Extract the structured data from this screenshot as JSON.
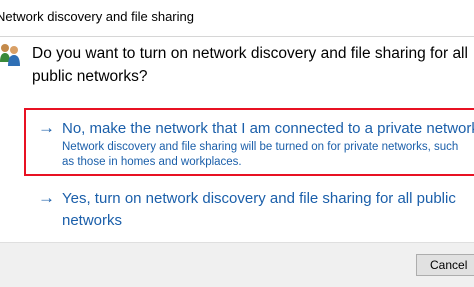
{
  "window": {
    "title": "Network discovery and file sharing"
  },
  "prompt": {
    "question": "Do you want to turn on network discovery and file sharing for all public networks?",
    "icon": "users-icon"
  },
  "options": [
    {
      "arrow": "→",
      "title": "No, make the network that I am connected to a private network",
      "description": "Network discovery and file sharing will be turned on for private networks, such as those in homes and workplaces.",
      "highlight_color": "#e81123"
    },
    {
      "arrow": "→",
      "title": "Yes, turn on network discovery and file sharing for all public networks"
    }
  ],
  "footer": {
    "cancel_label": "Cancel"
  },
  "colors": {
    "link_blue": "#1b5faa",
    "footer_bg": "#f0f0f0",
    "highlight": "#e81123"
  }
}
